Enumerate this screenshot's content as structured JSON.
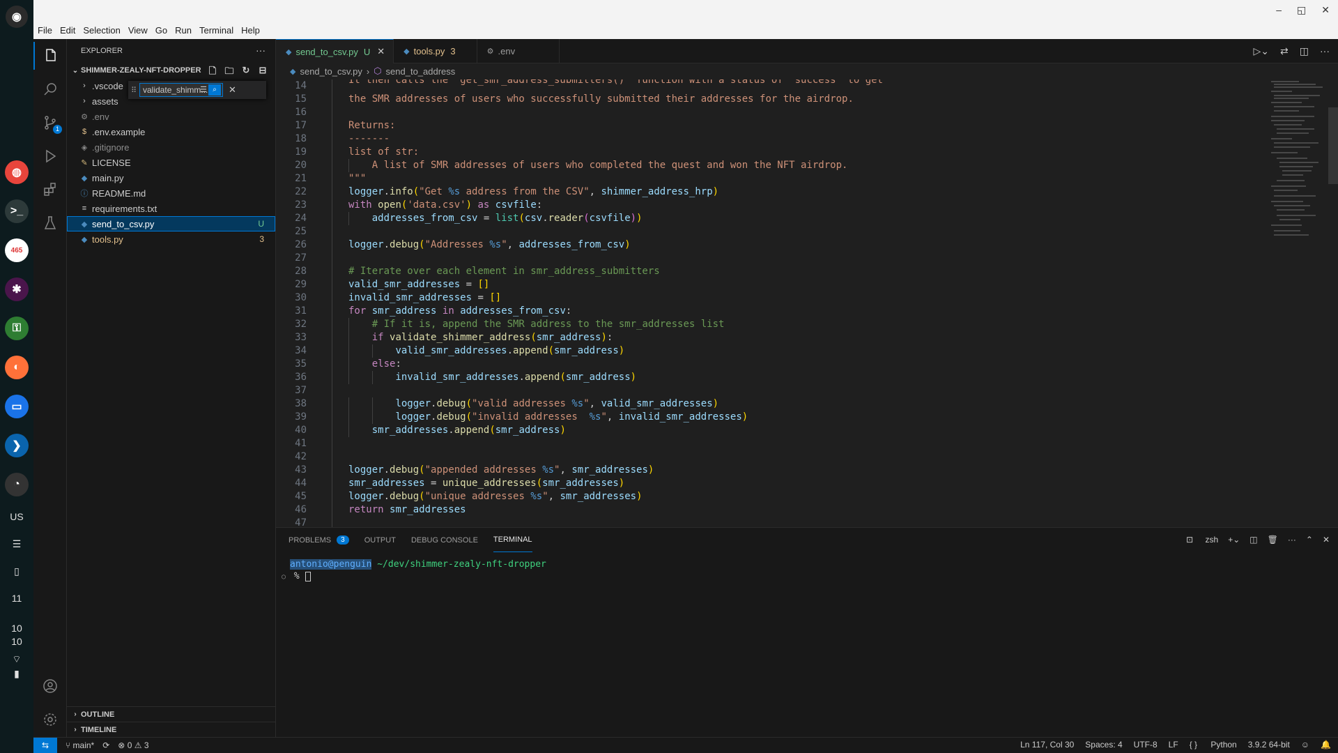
{
  "menu": [
    "File",
    "Edit",
    "Selection",
    "View",
    "Go",
    "Run",
    "Terminal",
    "Help"
  ],
  "window_controls": [
    "–",
    "◱",
    "✕"
  ],
  "dock": {
    "badge_counter": "465",
    "account_label": "US",
    "clock_hour": "10",
    "clock_minute": "10",
    "calendar_day": "11"
  },
  "activity": {
    "scm_badge": "1"
  },
  "sidebar": {
    "title": "EXPLORER",
    "folder": "SHIMMER-ZEALY-NFT-DROPPER",
    "find_value": "validate_shimm...",
    "items": [
      {
        "name": ".vscode",
        "type": "folder",
        "status": ""
      },
      {
        "name": "assets",
        "type": "folder",
        "status": ""
      },
      {
        "name": ".env",
        "type": "gear",
        "status": ""
      },
      {
        "name": ".env.example",
        "type": "dollar",
        "status": ""
      },
      {
        "name": ".gitignore",
        "type": "diamond",
        "status": ""
      },
      {
        "name": "LICENSE",
        "type": "license",
        "status": ""
      },
      {
        "name": "main.py",
        "type": "python",
        "status": ""
      },
      {
        "name": "README.md",
        "type": "info",
        "status": ""
      },
      {
        "name": "requirements.txt",
        "type": "lines",
        "status": ""
      },
      {
        "name": "send_to_csv.py",
        "type": "python",
        "status": "U"
      },
      {
        "name": "tools.py",
        "type": "python",
        "status": "3"
      }
    ],
    "outline": "OUTLINE",
    "timeline": "TIMELINE"
  },
  "tabs": [
    {
      "label": "send_to_csv.py",
      "suffix": "U",
      "active": true
    },
    {
      "label": "tools.py",
      "suffix": "3",
      "active": false
    },
    {
      "label": ".env",
      "suffix": "",
      "active": false
    }
  ],
  "breadcrumb": {
    "file": "send_to_csv.py",
    "symbol": "send_to_address"
  },
  "code": {
    "line_numbers": [
      "14",
      "15",
      "16",
      "17",
      "18",
      "19",
      "20",
      "21",
      "22",
      "23",
      "24",
      "25",
      "26",
      "27",
      "28",
      "29",
      "30",
      "31",
      "32",
      "33",
      "34",
      "35",
      "36",
      "37",
      "38",
      "39",
      "40",
      "41",
      "42",
      "43",
      "44",
      "45",
      "46",
      "47"
    ]
  },
  "panel": {
    "tabs": [
      "PROBLEMS",
      "OUTPUT",
      "DEBUG CONSOLE",
      "TERMINAL"
    ],
    "problems_count": "3",
    "shell": "zsh",
    "term_user": "antonio@penguin",
    "term_path": "~/dev/shimmer-zealy-nft-dropper",
    "term_prompt": "%"
  },
  "status": {
    "branch": "main*",
    "errors": "0",
    "warnings": "3",
    "position": "Ln 117, Col 30",
    "spaces": "Spaces: 4",
    "encoding": "UTF-8",
    "eol": "LF",
    "language": "Python",
    "interpreter": "3.9.2 64-bit"
  }
}
